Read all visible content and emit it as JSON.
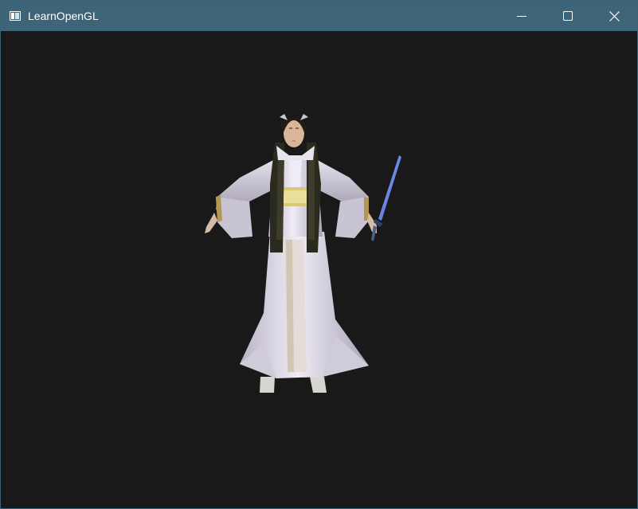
{
  "window": {
    "title": "LearnOpenGL",
    "app_icon": "window-app-icon",
    "controls": {
      "minimize": "minimize-icon",
      "maximize": "maximize-icon",
      "close": "close-icon"
    }
  },
  "viewport": {
    "background_color": "#191919",
    "content": "3d-character-model"
  },
  "colors": {
    "titlebar": "#3d6577",
    "title_text": "#ffffff"
  }
}
